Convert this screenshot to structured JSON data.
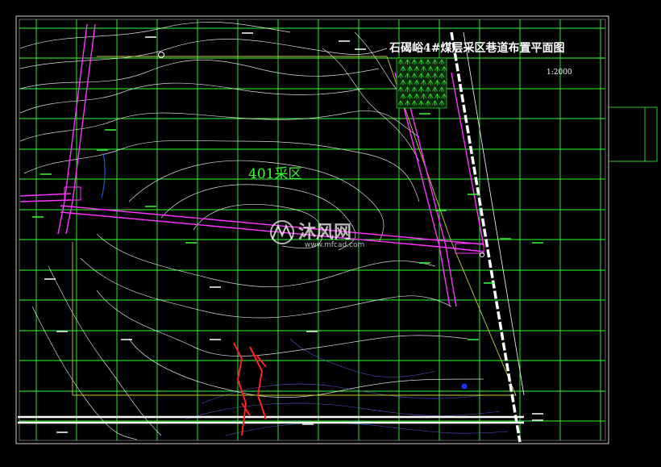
{
  "drawing": {
    "title": "石碣峪4#煤层采区巷道布置平面图",
    "scale": "1:2000",
    "area_label": "401采区"
  },
  "watermark": {
    "brand": "沐风网",
    "url": "www.mfcad.com"
  },
  "colors": {
    "background": "#000000",
    "grid": "#33ff33",
    "roadway": "#ff33ff",
    "contour": "#ffffff",
    "boundary": "#cccc33",
    "fault": "#ff2222",
    "label": "#33ff33"
  }
}
